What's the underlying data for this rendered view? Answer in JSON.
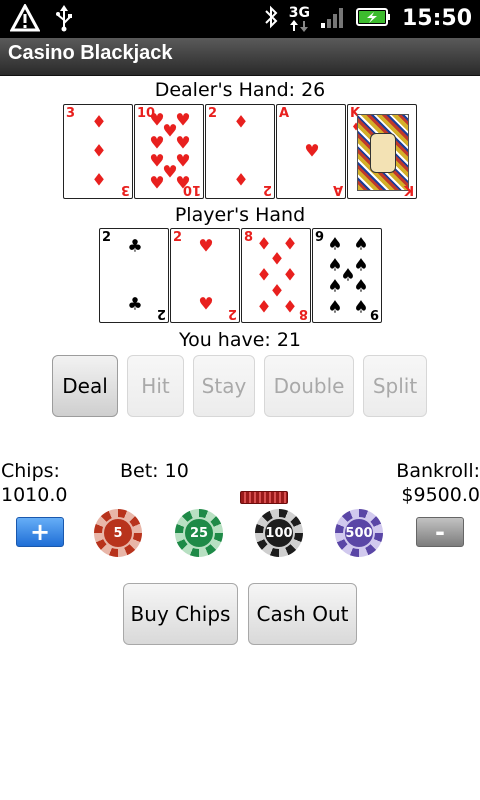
{
  "status_bar": {
    "time": "15:50",
    "network": "3G",
    "left_icons": [
      "warning-icon",
      "usb-icon"
    ],
    "right_icons": [
      "bluetooth-icon",
      "data-3g-icon",
      "signal-icon",
      "battery-icon"
    ]
  },
  "app": {
    "title": "Casino Blackjack"
  },
  "dealer": {
    "label": "Dealer's Hand: 26",
    "cards": [
      {
        "rank": "3",
        "suit": "♦",
        "color": "#e8201e"
      },
      {
        "rank": "10",
        "suit": "♥",
        "color": "#e8201e"
      },
      {
        "rank": "2",
        "suit": "♦",
        "color": "#e8201e"
      },
      {
        "rank": "A",
        "suit": "♥",
        "color": "#e8201e"
      },
      {
        "rank": "K",
        "suit": "♦",
        "color": "#e8201e"
      }
    ]
  },
  "player": {
    "label": "Player's Hand",
    "cards": [
      {
        "rank": "2",
        "suit": "♣",
        "color": "#000000"
      },
      {
        "rank": "2",
        "suit": "♥",
        "color": "#e8201e"
      },
      {
        "rank": "8",
        "suit": "♦",
        "color": "#e8201e"
      },
      {
        "rank": "9",
        "suit": "♠",
        "color": "#000000"
      }
    ],
    "total": "You have: 21"
  },
  "actions": {
    "deal": "Deal",
    "hit": "Hit",
    "stay": "Stay",
    "double": "Double",
    "split": "Split"
  },
  "wallet": {
    "chips_label": "Chips:",
    "chips_value": "1010.0",
    "bet": "Bet: 10",
    "bankroll_label": "Bankroll:",
    "bankroll_value": "$9500.0"
  },
  "controls": {
    "plus": "+",
    "minus": "-"
  },
  "chips": [
    {
      "value": "5",
      "color": "#b8331c",
      "ring": "#e8b6a8"
    },
    {
      "value": "25",
      "color": "#1e8a47",
      "ring": "#b8e0c2"
    },
    {
      "value": "100",
      "color": "#1d1d1d",
      "ring": "#cfcfcf"
    },
    {
      "value": "500",
      "color": "#5a46a6",
      "ring": "#d1c9ee"
    }
  ],
  "footer": {
    "buy": "Buy Chips",
    "cash_out": "Cash Out"
  }
}
